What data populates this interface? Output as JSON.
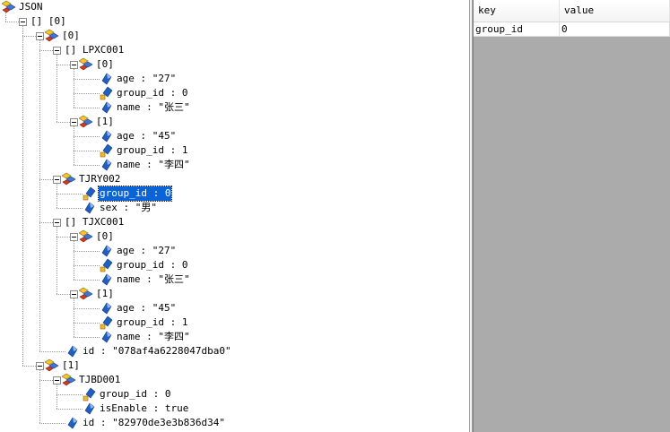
{
  "tree": [
    {
      "label": "JSON",
      "kind": "object",
      "expanded": true
    },
    {
      "label": "[] [0]",
      "kind": "array",
      "expanded": true
    },
    {
      "label": "[0]",
      "kind": "object",
      "expanded": true
    },
    {
      "label": "[] LPXC001",
      "kind": "array",
      "expanded": true
    },
    {
      "label": "[0]",
      "kind": "object",
      "expanded": true
    },
    {
      "label": "age : \"27\"",
      "kind": "string"
    },
    {
      "label": "group_id : 0",
      "kind": "number"
    },
    {
      "label": "name : \"张三\"",
      "kind": "string"
    },
    {
      "label": "[1]",
      "kind": "object",
      "expanded": true
    },
    {
      "label": "age : \"45\"",
      "kind": "string"
    },
    {
      "label": "group_id : 1",
      "kind": "number"
    },
    {
      "label": "name : \"李四\"",
      "kind": "string"
    },
    {
      "label": "TJRY002",
      "kind": "object",
      "expanded": true
    },
    {
      "label": "group_id : 0",
      "kind": "number",
      "selected": true
    },
    {
      "label": "sex : \"男\"",
      "kind": "string"
    },
    {
      "label": "[] TJXC001",
      "kind": "array",
      "expanded": true
    },
    {
      "label": "[0]",
      "kind": "object",
      "expanded": true
    },
    {
      "label": "age : \"27\"",
      "kind": "string"
    },
    {
      "label": "group_id : 0",
      "kind": "number"
    },
    {
      "label": "name : \"张三\"",
      "kind": "string"
    },
    {
      "label": "[1]",
      "kind": "object",
      "expanded": true
    },
    {
      "label": "age : \"45\"",
      "kind": "string"
    },
    {
      "label": "group_id : 1",
      "kind": "number"
    },
    {
      "label": "name : \"李四\"",
      "kind": "string"
    },
    {
      "label": "id : \"078af4a6228047dba0\"",
      "kind": "string"
    },
    {
      "label": "[1]",
      "kind": "object",
      "expanded": true
    },
    {
      "label": "TJBD001",
      "kind": "object",
      "expanded": true
    },
    {
      "label": "group_id : 0",
      "kind": "number"
    },
    {
      "label": "isEnable : true",
      "kind": "string"
    },
    {
      "label": "id : \"82970de3e3b836d34\"",
      "kind": "string"
    }
  ],
  "properties": {
    "headers": {
      "key": "key",
      "value": "value"
    },
    "rows": [
      {
        "key": "group_id",
        "value": "0"
      }
    ]
  },
  "colors": {
    "selection": "#0a64d6",
    "object_icon_yellow": "#f2c62f",
    "object_icon_blue": "#3b78d8",
    "object_icon_red": "#d43a2a",
    "leaf_icon_blue": "#1f5fbf",
    "number_icon_yellow": "#f0b82a",
    "pane_gray": "#ababab"
  }
}
